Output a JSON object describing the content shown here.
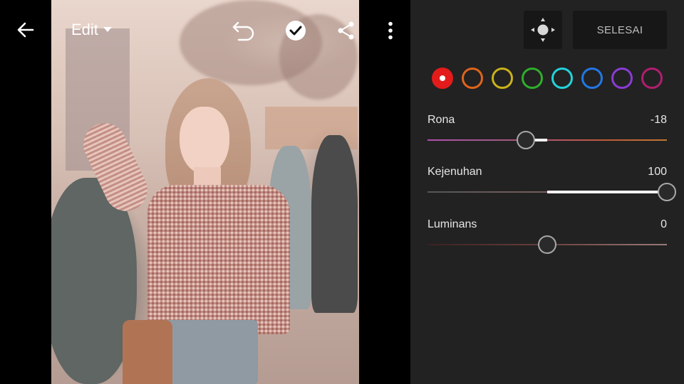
{
  "topbar": {
    "edit_label": "Edit",
    "icons": [
      "back-arrow-icon",
      "chevron-down-icon",
      "undo-icon",
      "checkmark-icon",
      "share-icon",
      "more-vertical-icon"
    ]
  },
  "panel": {
    "target_adjust_icon": "targeted-adjustment-icon",
    "finish_label": "SELESAI",
    "colors": [
      {
        "name": "merah",
        "hex": "#e31b1b",
        "selected": true
      },
      {
        "name": "oranye",
        "hex": "#e0641c",
        "selected": false
      },
      {
        "name": "kuning",
        "hex": "#c9b21a",
        "selected": false
      },
      {
        "name": "hijau",
        "hex": "#2fae2c",
        "selected": false
      },
      {
        "name": "akua",
        "hex": "#22d3dc",
        "selected": false
      },
      {
        "name": "biru",
        "hex": "#2277e6",
        "selected": false
      },
      {
        "name": "ungu",
        "hex": "#8b3bd6",
        "selected": false
      },
      {
        "name": "magenta",
        "hex": "#b01e6f",
        "selected": false
      }
    ],
    "sliders": [
      {
        "label": "Rona",
        "value": "-18",
        "min": -100,
        "max": 100,
        "num": -18,
        "track": [
          "#b24fb0",
          "#9e5a8a",
          "#b4556a",
          "#c05a3a",
          "#c07832"
        ]
      },
      {
        "label": "Kejenuhan",
        "value": "100",
        "min": -100,
        "max": 100,
        "num": 100,
        "track": [
          "#555555",
          "#7a5e5e",
          "#9a6a6a"
        ]
      },
      {
        "label": "Luminans",
        "value": "0",
        "min": -100,
        "max": 100,
        "num": 0,
        "track": [
          "#3a2020",
          "#6a4040",
          "#9a7a7a"
        ]
      }
    ]
  }
}
